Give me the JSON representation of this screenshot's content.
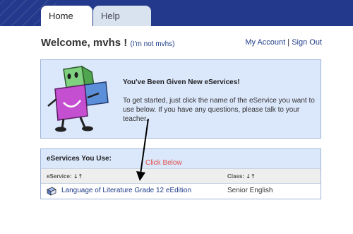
{
  "tabs": [
    {
      "label": "Home"
    },
    {
      "label": "Help"
    }
  ],
  "welcome": {
    "text": "Welcome, mvhs !",
    "not_me": "(I'm not mvhs)"
  },
  "account_links": {
    "my_account": "My Account",
    "separator": "|",
    "sign_out": "Sign Out"
  },
  "notice": {
    "title": "You've Been Given New eServices!",
    "body": "To get started, just click the name of the eService you want to use below. If you have any questions, please talk to your teacher."
  },
  "eservices": {
    "title": "eServices You Use:",
    "annotation": "Click Below",
    "columns": {
      "eservice": "eService:",
      "class": "Class:",
      "sort_glyph": "⇣⇡"
    },
    "rows": [
      {
        "name": "Language of Literature Grade 12 eEdition",
        "class": "Senior English",
        "icon": "book-icon"
      }
    ]
  },
  "colors": {
    "topbar": "#233a8c",
    "panel_bg": "#dbe7fb",
    "link": "#1f3c88",
    "annotation": "#e0504a"
  }
}
